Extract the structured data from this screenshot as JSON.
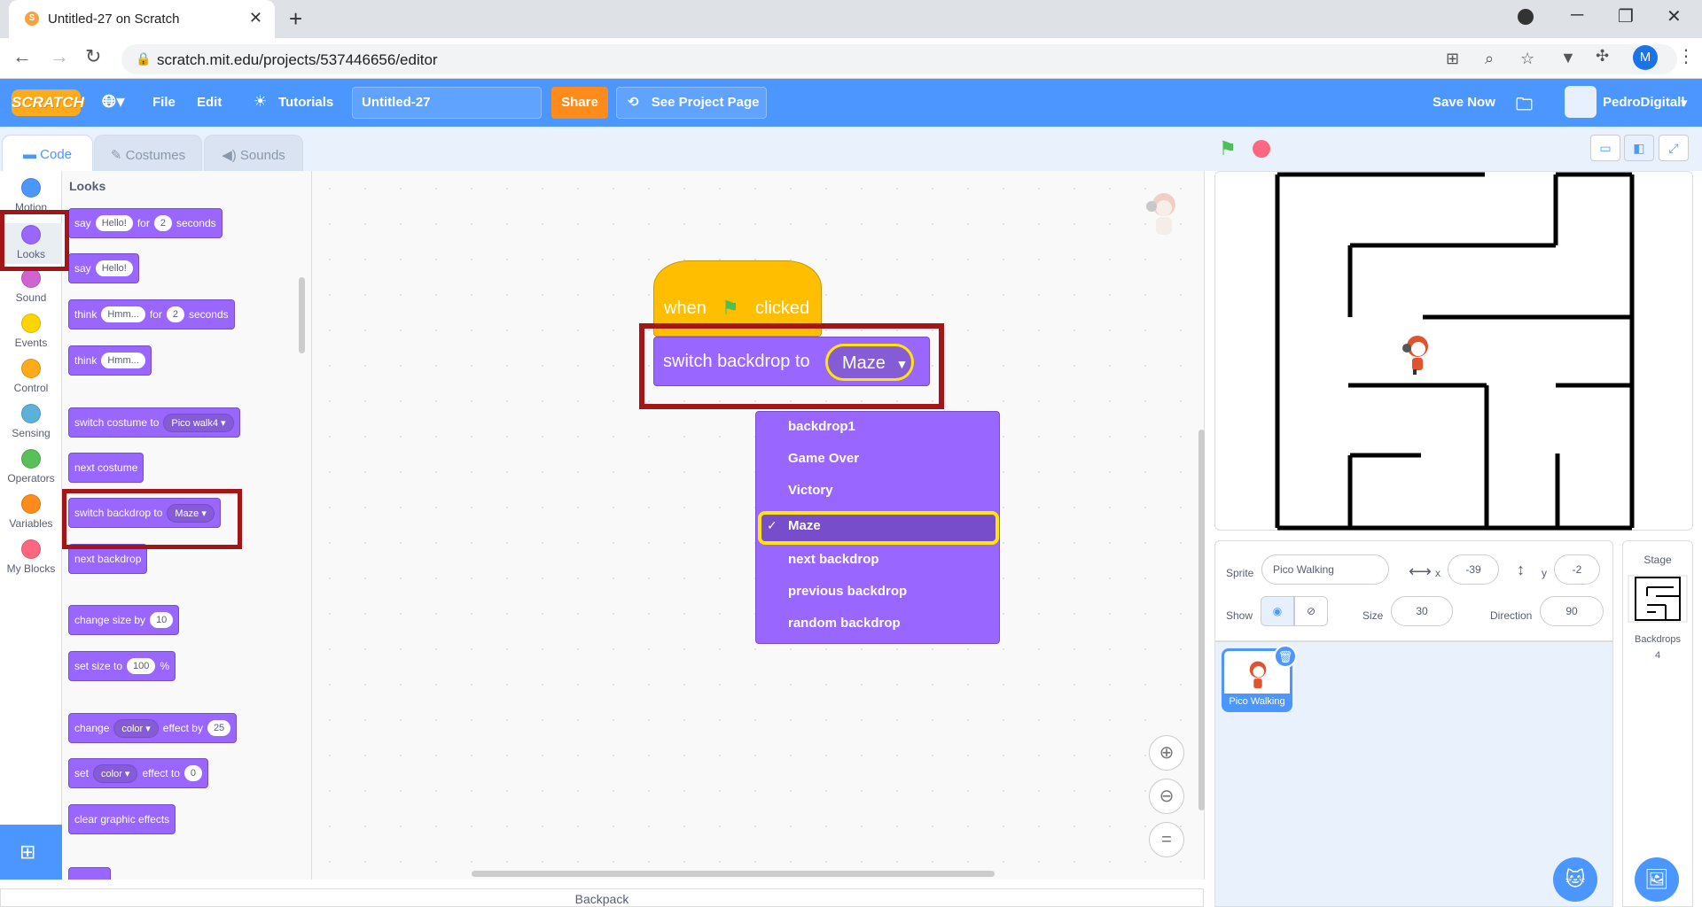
{
  "browser": {
    "tab_title": "Untitled-27 on Scratch",
    "url": "scratch.mit.edu/projects/537446656/editor",
    "profile_initial": "M"
  },
  "menubar": {
    "logo": "SCRATCH",
    "file": "File",
    "edit": "Edit",
    "tutorials": "Tutorials",
    "project_title": "Untitled-27",
    "share": "Share",
    "see_project_page": "See Project Page",
    "save_now": "Save Now",
    "username": "PedroDigitall"
  },
  "editor_tabs": {
    "code": "Code",
    "costumes": "Costumes",
    "sounds": "Sounds"
  },
  "categories": [
    {
      "label": "Motion",
      "color": "#4c97ff"
    },
    {
      "label": "Looks",
      "color": "#9966ff"
    },
    {
      "label": "Sound",
      "color": "#cf63cf"
    },
    {
      "label": "Events",
      "color": "#ffd500"
    },
    {
      "label": "Control",
      "color": "#ffab19"
    },
    {
      "label": "Sensing",
      "color": "#5cb1d6"
    },
    {
      "label": "Operators",
      "color": "#59c059"
    },
    {
      "label": "Variables",
      "color": "#ff8c1a"
    },
    {
      "label": "My Blocks",
      "color": "#ff6680"
    }
  ],
  "palette": {
    "heading": "Looks",
    "say_for": {
      "w1": "say",
      "v1": "Hello!",
      "w2": "for",
      "v2": "2",
      "w3": "seconds"
    },
    "say": {
      "w1": "say",
      "v1": "Hello!"
    },
    "think_for": {
      "w1": "think",
      "v1": "Hmm...",
      "w2": "for",
      "v2": "2",
      "w3": "seconds"
    },
    "think": {
      "w1": "think",
      "v1": "Hmm..."
    },
    "switch_costume": {
      "w1": "switch costume to",
      "v1": "Pico walk4"
    },
    "next_costume": "next costume",
    "switch_backdrop": {
      "w1": "switch backdrop to",
      "v1": "Maze"
    },
    "next_backdrop": "next backdrop",
    "change_size": {
      "w1": "change size by",
      "v1": "10"
    },
    "set_size": {
      "w1": "set size to",
      "v1": "100",
      "w2": "%"
    },
    "change_effect": {
      "w1": "change",
      "v1": "color",
      "w2": "effect by",
      "v2": "25"
    },
    "set_effect": {
      "w1": "set",
      "v1": "color",
      "w2": "effect to",
      "v2": "0"
    },
    "clear_effects": "clear graphic effects"
  },
  "script": {
    "hat_when": "when",
    "hat_clicked": "clicked",
    "switch_label": "switch backdrop to",
    "switch_value": "Maze"
  },
  "dropdown": {
    "items": [
      "backdrop1",
      "Game Over",
      "Victory",
      "Maze",
      "next backdrop",
      "previous backdrop",
      "random backdrop"
    ],
    "selected": "Maze",
    "checkmark": "✓"
  },
  "backpack": "Backpack",
  "sprite_info": {
    "sprite_label": "Sprite",
    "sprite_name": "Pico Walking",
    "x_label": "x",
    "x": "-39",
    "y_label": "y",
    "y": "-2",
    "show_label": "Show",
    "size_label": "Size",
    "size": "30",
    "direction_label": "Direction",
    "direction": "90"
  },
  "sprite_tile": "Pico Walking",
  "stage_panel": {
    "title": "Stage",
    "backdrops_label": "Backdrops",
    "backdrops_count": "4"
  }
}
